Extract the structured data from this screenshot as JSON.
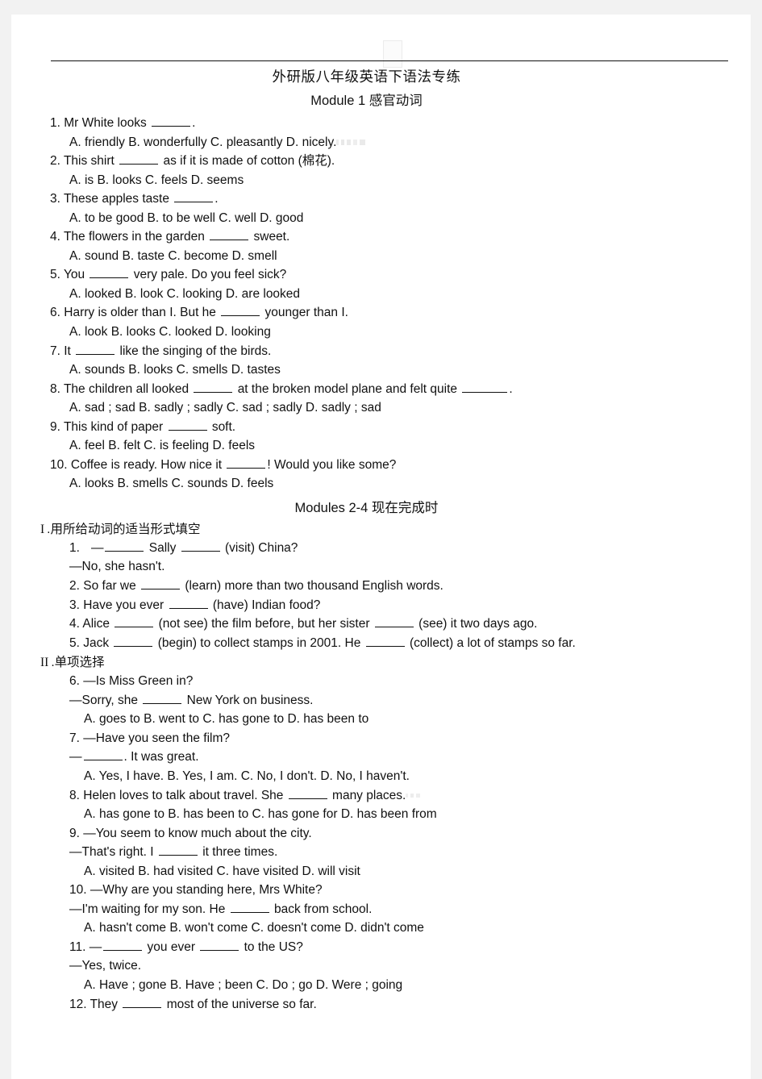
{
  "document": {
    "title": "外研版八年级英语下语法专练",
    "module1_heading": "Module 1  感官动词",
    "modules24_heading": "Modules 2-4  现在完成时",
    "section_fill_label": ".用所给动词的适当形式填空",
    "section_fill_numeral": "I",
    "section_choice_label": ".单项选择",
    "section_choice_numeral": "II"
  },
  "module1": {
    "questions": [
      {
        "num": "1.",
        "stem_before": "Mr  White  looks",
        "stem_after": ".",
        "options": "A. friendly     B. wonderfully     C. pleasantly   D. nicely."
      },
      {
        "num": "2.",
        "stem_before": "This  shirt",
        "stem_after": "as  if  it  is  made  of  cotton (棉花).",
        "options": "A. is   B. looks   C. feels   D. seems"
      },
      {
        "num": "3.",
        "stem_before": "These  apples  taste",
        "stem_after": ".",
        "options": "A. to be good   B. to be well    C. well    D. good"
      },
      {
        "num": "4.",
        "stem_before": "The  flowers  in  the  garden",
        "stem_after": "sweet.",
        "options": "A. sound   B. taste   C. become   D. smell"
      },
      {
        "num": "5.",
        "stem_before": "You",
        "stem_after": "very  pale.  Do  you  feel  sick?",
        "options": "A. looked   B. look    C. looking    D. are looked"
      },
      {
        "num": "6.",
        "stem_before": "Harry  is  older  than  I.  But  he",
        "stem_after": "younger  than  I.",
        "options": "A. look    B. looks    C. looked    D. looking"
      },
      {
        "num": "7.",
        "stem_before": "It",
        "stem_after": "like  the  singing  of  the  birds.",
        "options": "A. sounds   B. looks    C. smells    D. tastes"
      },
      {
        "num": "8.",
        "stem_before": "The  children  all  looked",
        "stem_mid": "at  the  broken  model  plane  and  felt  quite",
        "stem_after": ".",
        "options": "A. sad ; sad   B. sadly ; sadly   C. sad ; sadly   D. sadly ; sad"
      },
      {
        "num": "9.",
        "stem_before": "This  kind  of  paper",
        "stem_after": "soft.",
        "options": "A. feel    B. felt    C. is feeling    D. feels"
      },
      {
        "num": "10.",
        "stem_before": "Coffee  is  ready.  How  nice  it",
        "stem_after": "!  Would  you  like  some?",
        "options": "A. looks    B. smells    C. sounds    D. feels"
      }
    ]
  },
  "fill_in_blanks": [
    {
      "num": "1.",
      "line1_before": "—",
      "line1_mid": "Sally",
      "line1_after": "(visit)  China?",
      "line2": "—No,  she  hasn't."
    },
    {
      "num": "2.",
      "stem_before": "So  far  we",
      "stem_after": "(learn)  more  than  two  thousand  English  words."
    },
    {
      "num": "3.",
      "stem_before": "Have  you  ever",
      "stem_after": "(have)  Indian  food?"
    },
    {
      "num": "4.",
      "stem_before": "Alice",
      "stem_mid": "(not see)  the  film  before,  but  her  sister",
      "stem_after": "(see)  it  two  days  ago."
    },
    {
      "num": "5.",
      "stem_before": "Jack",
      "stem_mid": "(begin)  to  collect  stamps  in  2001.  He",
      "stem_after": "(collect)  a  lot  of  stamps  so  far."
    }
  ],
  "multiple_choice": [
    {
      "num": "6.",
      "line1": "—Is  Miss  Green  in?",
      "line2_before": "—Sorry,  she",
      "line2_after": "New  York  on  business.",
      "options": "A. goes to   B. went to    C. has gone to   D. has been to"
    },
    {
      "num": "7.",
      "line1": "—Have  you  seen  the  film?",
      "line2_before": "—",
      "line2_after": ".  It  was  great.",
      "options": "A. Yes, I have.    B. Yes, I am.    C. No, I don't.    D. No, I haven't."
    },
    {
      "num": "8.",
      "stem_before": "Helen  loves  to  talk  about  travel.  She",
      "stem_after": "many  places.",
      "options": "A. has gone to   B. has been to   C. has gone for   D. has been from"
    },
    {
      "num": "9.",
      "line1": "—You  seem  to  know  much  about  the  city.",
      "line2_before": "—That's  right.  I",
      "line2_after": "it  three  times.",
      "options": "A. visited    B. had visited    C. have visited   D. will visit"
    },
    {
      "num": "10.",
      "line1": "—Why  are  you  standing  here,  Mrs  White?",
      "line2_before": "—I'm  waiting  for  my  son.  He",
      "line2_after": "back  from  school.",
      "options": "A. hasn't come   B. won't come   C. doesn't come   D. didn't come"
    },
    {
      "num": "11.",
      "line1_before": "—",
      "line1_mid": "you  ever",
      "line1_after": "to  the  US?",
      "line2": "—Yes,  twice.",
      "options": "A. Have ; gone   B. Have ; been   C. Do ; go    D. Were ; going"
    },
    {
      "num": "12.",
      "stem_before": "They",
      "stem_after": "most  of  the  universe  so  far."
    }
  ]
}
